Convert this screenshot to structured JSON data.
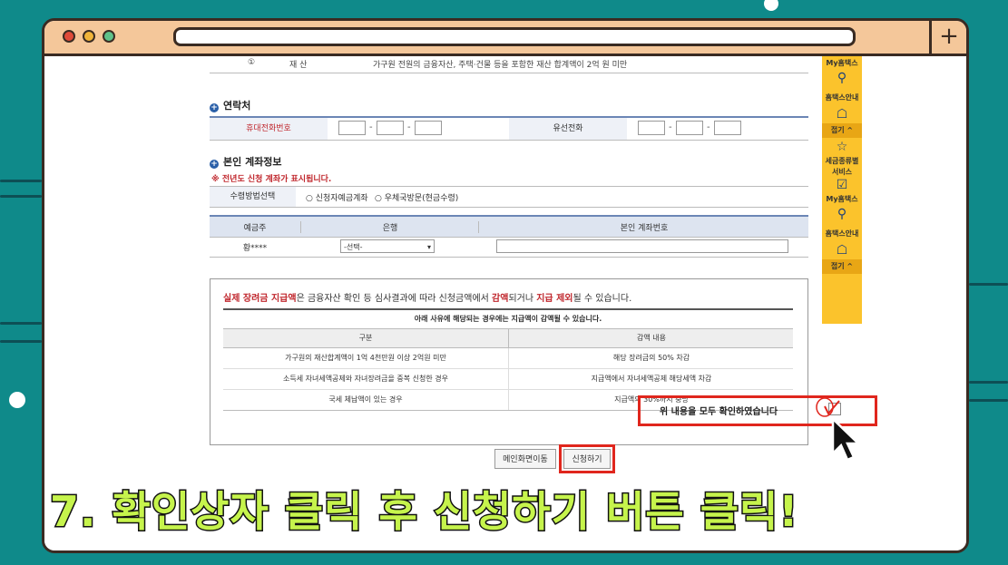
{
  "window": {
    "plus_label": "+"
  },
  "top_row": {
    "num": "①",
    "name": "재    산",
    "desc": "가구원 전원의 금융자산, 주택·건물 등을 포함한 재산 합계액이 2억 원 미만"
  },
  "contact": {
    "title": "연락처",
    "mobile_label": "휴대전화번호",
    "landline_label": "유선전화",
    "dash": "-"
  },
  "account": {
    "title": "본인 계좌정보",
    "note": "※ 전년도 신청 계좌가 표시됩니다.",
    "receive_label": "수령방법선택",
    "option1": "신청자예금계좌",
    "option2": "우체국방문(현금수령)",
    "headers": [
      "예금주",
      "은행",
      "본인 계좌번호"
    ],
    "holder": "황****",
    "bank_select": "-선택-"
  },
  "notice": {
    "line_p1": "실제 장려금 지급액",
    "line_p2": "은 금융자산 확인 등 심사결과에 따라 신청금액에서 ",
    "line_p3": "감액",
    "line_p4": "되거나 ",
    "line_p5": "지급 제외",
    "line_p6": "될 수 있습니다.",
    "table_caption": "아래 사유에 해당되는 경우에는 지급액이 감액될 수 있습니다.",
    "col1": "구분",
    "col2": "감액 내용",
    "rows": [
      {
        "reason": "가구원의 재산합계액이 1억 4천만원 이상 2억원 미만",
        "cut": "해당 장려금의 50% 차감"
      },
      {
        "reason": "소득세 자녀세액공제와 자녀장려금을 중복 신청한 경우",
        "cut": "지급액에서 자녀세액공제 해당세액 차감"
      },
      {
        "reason": "국세 체납액이 있는 경우",
        "cut": "지급액의 30%까지 충당"
      }
    ],
    "confirm_text": "위 내용을 모두 확인하였습니다"
  },
  "buttons": {
    "prev": "메인화면이동",
    "apply": "신청하기"
  },
  "sidebar": {
    "my1": "My홈택스",
    "guide1": "홈택스안내",
    "fold1": "접기 ^",
    "tax": "세금종류별 서비스",
    "my2": "My홈택스",
    "guide2": "홈택스안내",
    "fold2": "접기 ^"
  },
  "caption": "7. 확인상자 클릭 후 신청하기 버튼 클릭!",
  "colors": {
    "bg": "#0f8a8a",
    "accent_red": "#e0261d",
    "caption": "#c6f44c",
    "sidebar": "#fbc32c"
  }
}
